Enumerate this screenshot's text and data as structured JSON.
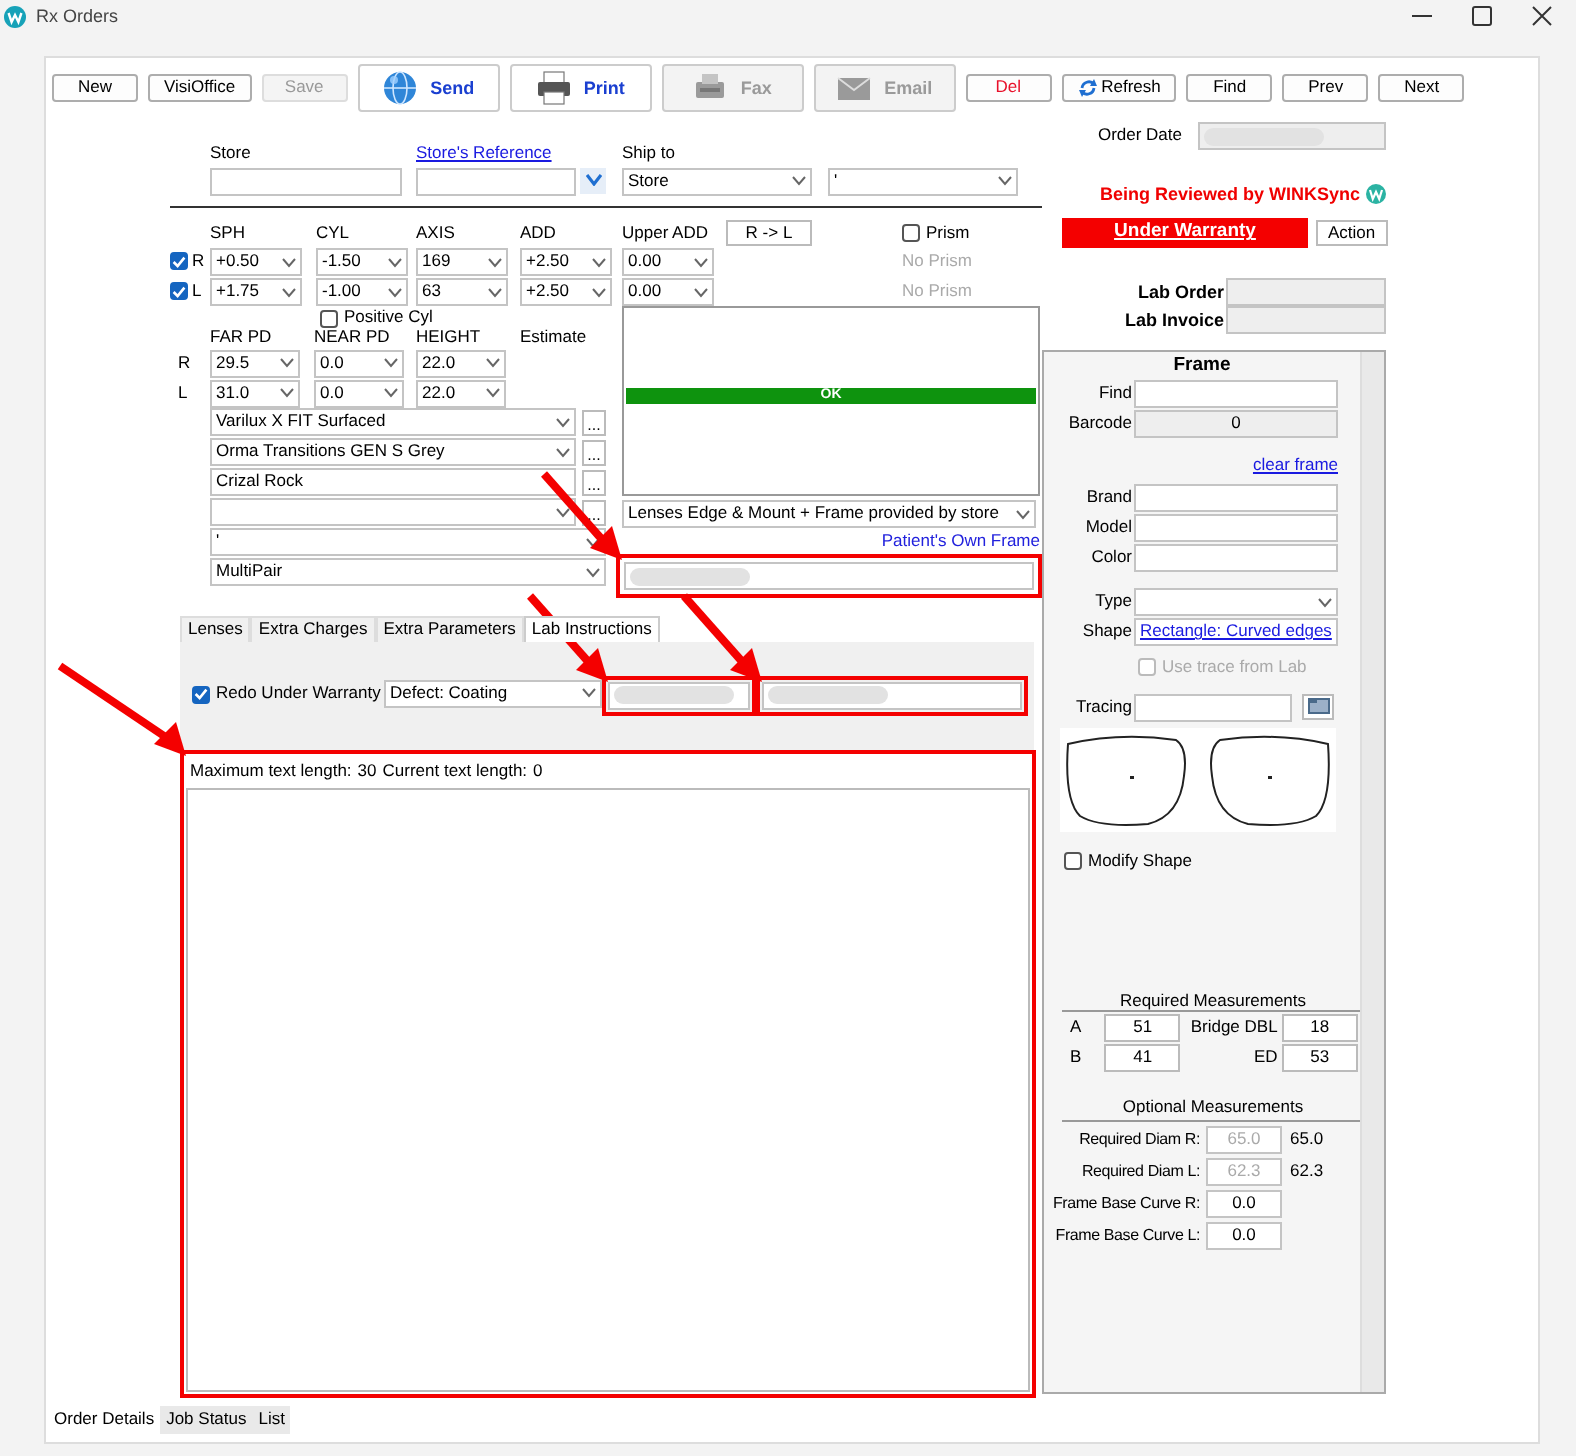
{
  "window": {
    "title": "Rx Orders"
  },
  "toolbar": [
    {
      "label": "New",
      "kind": "plain",
      "disabled": false
    },
    {
      "label": "VisiOffice",
      "kind": "plain",
      "disabled": false
    },
    {
      "label": "Save",
      "kind": "plain",
      "disabled": true
    },
    {
      "label": "Send",
      "kind": "globe",
      "disabled": false
    },
    {
      "label": "Print",
      "kind": "printer",
      "disabled": false
    },
    {
      "label": "Fax",
      "kind": "fax",
      "disabled": true
    },
    {
      "label": "Email",
      "kind": "envelope",
      "disabled": true
    },
    {
      "label": "Del",
      "kind": "danger",
      "disabled": false
    },
    {
      "label": "Refresh",
      "kind": "refresh",
      "disabled": false
    },
    {
      "label": "Find",
      "kind": "plain",
      "disabled": false
    },
    {
      "label": "Prev",
      "kind": "plain",
      "disabled": false
    },
    {
      "label": "Next",
      "kind": "plain",
      "disabled": false
    }
  ],
  "order_date": {
    "label": "Order Date",
    "redacted": true
  },
  "store": {
    "label": "Store"
  },
  "store_reference": {
    "label": "Store's Reference"
  },
  "ship_to": {
    "label": "Ship to",
    "value": "Store",
    "second_value": "'"
  },
  "review_status": {
    "text": "Being Reviewed by WINKSync"
  },
  "warranty": {
    "label": "Under Warranty",
    "action": "Action"
  },
  "lab": [
    {
      "label": "Lab Order"
    },
    {
      "label": "Lab Invoice"
    }
  ],
  "rx": {
    "columns": [
      "SPH",
      "CYL",
      "AXIS",
      "ADD",
      "Upper ADD"
    ],
    "copy_button": "R -> L",
    "prism": {
      "label": "Prism",
      "checked": false
    },
    "rows": [
      {
        "eye": "R",
        "checked": true,
        "values": [
          "+0.50",
          "-1.50",
          "169",
          "+2.50",
          "0.00"
        ],
        "prism_note": "No Prism"
      },
      {
        "eye": "L",
        "checked": true,
        "values": [
          "+1.75",
          "-1.00",
          "63",
          "+2.50",
          "0.00"
        ],
        "prism_note": "No Prism"
      }
    ],
    "positive_cyl": {
      "label": "Positive Cyl",
      "checked": false
    }
  },
  "pd": {
    "columns": [
      "FAR PD",
      "NEAR PD",
      "HEIGHT",
      "Estimate"
    ],
    "rows": [
      {
        "eye": "R",
        "values": [
          "29.5",
          "0.0",
          "22.0"
        ]
      },
      {
        "eye": "L",
        "values": [
          "31.0",
          "0.0",
          "22.0"
        ]
      }
    ]
  },
  "lens_options": [
    {
      "kind": "select",
      "value": "Varilux X FIT Surfaced",
      "more": "..."
    },
    {
      "kind": "select",
      "value": "Orma Transitions GEN S Grey",
      "more": "..."
    },
    {
      "kind": "text",
      "value": "Crizal Rock",
      "more": "..."
    },
    {
      "kind": "select",
      "more": "..."
    },
    {
      "kind": "select",
      "value": "'"
    },
    {
      "kind": "select",
      "value": "MultiPair"
    }
  ],
  "status_box": {
    "text": "OK"
  },
  "service": {
    "value": "Lenses Edge & Mount + Frame provided by store",
    "link": "Patient's Own Frame"
  },
  "service_note": {
    "redacted": true,
    "highlighted": true,
    "arrow": true
  },
  "tabs": [
    {
      "label": "Lenses",
      "selected": false
    },
    {
      "label": "Extra Charges",
      "selected": false
    },
    {
      "label": "Extra Parameters",
      "selected": false
    },
    {
      "label": "Lab Instructions",
      "selected": true
    }
  ],
  "lab_instructions": {
    "redo": {
      "label": "Redo Under Warranty",
      "checked": true
    },
    "defect": {
      "value": "Defect: Coating"
    },
    "fields": [
      {
        "redacted": true,
        "highlighted": true,
        "arrow": true
      },
      {
        "redacted": true,
        "highlighted": true,
        "arrow": true
      }
    ],
    "notes": {
      "max_label": "Maximum text length:",
      "max": "30",
      "current_label": "Current text length:",
      "current": "0",
      "highlighted": true,
      "arrow": true
    }
  },
  "frame": {
    "title": "Frame",
    "find": {
      "label": "Find"
    },
    "barcode": {
      "label": "Barcode",
      "value": "0"
    },
    "clear_link": "clear frame",
    "fields": [
      {
        "label": "Brand"
      },
      {
        "label": "Model"
      },
      {
        "label": "Color"
      }
    ],
    "type": {
      "label": "Type"
    },
    "shape": {
      "label": "Shape",
      "value": "Rectangle: Curved edges"
    },
    "use_trace": {
      "label": "Use trace from Lab",
      "checked": false,
      "disabled": true
    },
    "tracing": {
      "label": "Tracing"
    },
    "modify_shape": {
      "label": "Modify Shape",
      "checked": false
    },
    "required": {
      "title": "Required Measurements",
      "rows": [
        {
          "label": "A",
          "value": "51",
          "label2": "Bridge DBL",
          "value2": "18"
        },
        {
          "label": "B",
          "value": "41",
          "label2": "ED",
          "value2": "53"
        }
      ]
    },
    "optional": {
      "title": "Optional Measurements",
      "rows": [
        {
          "label": "Required Diam R:",
          "value": "65.0",
          "disabled": true,
          "reading": "65.0"
        },
        {
          "label": "Required Diam L:",
          "value": "62.3",
          "disabled": true,
          "reading": "62.3"
        },
        {
          "label": "Frame Base Curve R:",
          "value": "0.0",
          "disabled": false
        },
        {
          "label": "Frame Base Curve L:",
          "value": "0.0",
          "disabled": false
        }
      ]
    }
  },
  "bottom_tabs": [
    {
      "label": "Order Details",
      "selected": true
    },
    {
      "label": "Job Status",
      "selected": false
    },
    {
      "label": "List",
      "selected": false
    }
  ]
}
